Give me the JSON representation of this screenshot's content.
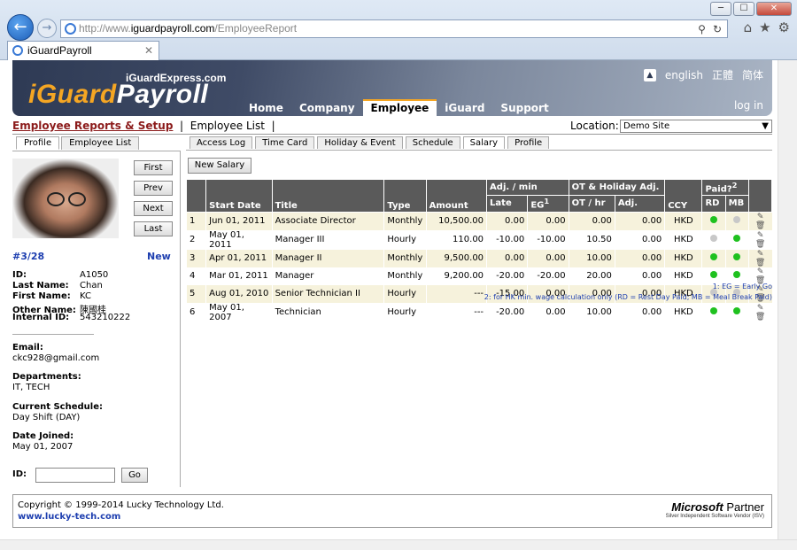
{
  "browser": {
    "url_prefix": "http://www.",
    "url_domain": "iguardpayroll.com",
    "url_path": "/EmployeeReport",
    "tab_title": "iGuardPayroll",
    "tab_close": "✕",
    "win_min": "─",
    "win_max": "☐",
    "win_close": "✕",
    "back": "←",
    "forward": "→",
    "addr_search": "⚲",
    "addr_refresh": "↻",
    "home_icon": "⌂",
    "star_icon": "★",
    "gear_icon": "⚙"
  },
  "header": {
    "site_sub": "iGuardExpress.com",
    "logo_prefix": "i",
    "logo_main": "Guard",
    "logo_suffix": "Payroll",
    "lang_icon": "▲",
    "lang_en": "english",
    "lang_tc": "正體",
    "lang_sc": "简体",
    "nav": [
      "Home",
      "Company",
      "Employee",
      "iGuard",
      "Support"
    ],
    "active_nav": "Employee",
    "login": "log in"
  },
  "breadcrumb": {
    "section": "Employee Reports & Setup",
    "sep": "|",
    "page": "Employee List",
    "sep2": "|"
  },
  "location": {
    "label": "Location:",
    "value": "Demo Site",
    "arrow": "▼"
  },
  "left_tabs": [
    "Profile",
    "Employee List"
  ],
  "left_nav": [
    "First",
    "Prev",
    "Next",
    "Last"
  ],
  "record": {
    "no": "#3/28",
    "new_link": "New"
  },
  "employee": {
    "id_label": "ID:",
    "id": "A1050",
    "last_label": "Last Name:",
    "last": "Chan",
    "first_label": "First Name:",
    "first": "KC",
    "other_label": "Other Name:",
    "other": "陳國桂",
    "internal_label": "Internal ID:",
    "internal": "543210222",
    "email_label": "Email:",
    "email": "ckc928@gmail.com",
    "dept_label": "Departments:",
    "dept": "IT, TECH",
    "sched_label": "Current Schedule:",
    "sched": "Day Shift (DAY)",
    "joined_label": "Date Joined:",
    "joined": "May 01, 2007"
  },
  "id_search": {
    "label": "ID:",
    "go": "Go"
  },
  "right_tabs": [
    "Access Log",
    "Time Card",
    "Holiday & Event",
    "Schedule",
    "Salary",
    "Profile"
  ],
  "active_right_tab": "Salary",
  "new_salary": "New Salary",
  "salary_headers": {
    "start": "Start Date",
    "title": "Title",
    "type": "Type",
    "amount": "Amount",
    "adj": "Adj. / min",
    "late": "Late",
    "eg": "EG",
    "eg_sup": "1",
    "ot": "OT & Holiday Adj.",
    "ot_hr": "OT / hr",
    "ot_adj": "Adj.",
    "ccy": "CCY",
    "paid": "Paid?",
    "paid_sup": "2",
    "rd": "RD",
    "mb": "MB"
  },
  "salary_rows": [
    {
      "n": "1",
      "start": "Jun 01, 2011",
      "title": "Associate Director",
      "type": "Monthly",
      "amount": "10,500.00",
      "late": "0.00",
      "eg": "0.00",
      "ot": "0.00",
      "adj": "0.00",
      "ccy": "HKD",
      "rd": "on",
      "mb": "off"
    },
    {
      "n": "2",
      "start": "May 01, 2011",
      "title": "Manager III",
      "type": "Hourly",
      "amount": "110.00",
      "late": "-10.00",
      "eg": "-10.00",
      "ot": "10.50",
      "adj": "0.00",
      "ccy": "HKD",
      "rd": "off",
      "mb": "on"
    },
    {
      "n": "3",
      "start": "Apr 01, 2011",
      "title": "Manager II",
      "type": "Monthly",
      "amount": "9,500.00",
      "late": "0.00",
      "eg": "0.00",
      "ot": "10.00",
      "adj": "0.00",
      "ccy": "HKD",
      "rd": "on",
      "mb": "on"
    },
    {
      "n": "4",
      "start": "Mar 01, 2011",
      "title": "Manager",
      "type": "Monthly",
      "amount": "9,200.00",
      "late": "-20.00",
      "eg": "-20.00",
      "ot": "20.00",
      "adj": "0.00",
      "ccy": "HKD",
      "rd": "on",
      "mb": "on"
    },
    {
      "n": "5",
      "start": "Aug 01, 2010",
      "title": "Senior Technician II",
      "type": "Hourly",
      "amount": "---",
      "late": "-15.00",
      "eg": "0.00",
      "ot": "0.00",
      "adj": "0.00",
      "ccy": "HKD",
      "rd": "off",
      "mb": "off"
    },
    {
      "n": "6",
      "start": "May 01, 2007",
      "title": "Technician",
      "type": "Hourly",
      "amount": "---",
      "late": "-20.00",
      "eg": "0.00",
      "ot": "10.00",
      "adj": "0.00",
      "ccy": "HKD",
      "rd": "on",
      "mb": "on"
    }
  ],
  "notes": {
    "n1": "1: EG = Early Go",
    "n2": "2: for HK min. wage calculation only (RD = Rest Day Paid; MB = Meal Break Paid)"
  },
  "footer": {
    "copyright": "Copyright © 1999-2014 Lucky Technology Ltd.",
    "link": "www.lucky-tech.com",
    "ms_brand": "Microsoft",
    "ms_partner": " Partner",
    "ms_sub": "Silver Independent Software Vendor (ISV)"
  },
  "colors": {
    "link_blue": "#1e3fb0",
    "crumb_red": "#8b1a1a",
    "accent_orange": "#f5a623",
    "header_gray": "#5a5a5a",
    "row_tint": "#f6f2dc",
    "dot_green": "#1fc11f",
    "dot_gray": "#c8c8c8"
  }
}
